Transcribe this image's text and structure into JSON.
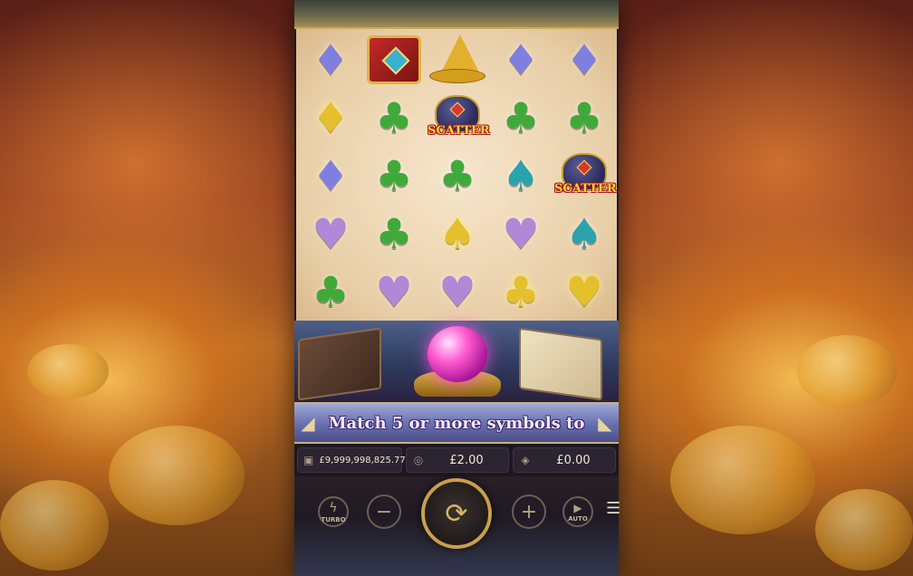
{
  "game": {
    "reels": [
      [
        "diamond",
        "book-wild",
        "hat-wild",
        "diamond",
        "diamond"
      ],
      [
        "diamond-gold",
        "club",
        "scatter",
        "club",
        "club"
      ],
      [
        "diamond",
        "club",
        "club",
        "spade",
        "scatter"
      ],
      [
        "heart",
        "club",
        "spade-gold",
        "heart",
        "spade"
      ],
      [
        "club",
        "heart",
        "heart",
        "club-gold",
        "heart-gold"
      ]
    ],
    "scatter_label": "SCATTER",
    "banner_text": "Match 5 or more symbols to",
    "colors": {
      "diamond": "#7f7fe0",
      "club": "#3faa3a",
      "heart": "#b088d8",
      "spade": "#2aa3ad",
      "gold": "#e5c02d"
    }
  },
  "info_bar": {
    "balance_icon": "wallet-icon",
    "balance": "£9,999,998,825.77",
    "bet_icon": "coin-stack-icon",
    "bet": "£2.00",
    "win_icon": "win-icon",
    "win": "£0.00"
  },
  "controls": {
    "turbo_label": "TURBO",
    "auto_label": "AUTO",
    "minus_symbol": "−",
    "plus_symbol": "+",
    "spin_symbol": "⟳",
    "menu_symbol": "☰"
  },
  "symbols": {
    "diamond": "♦",
    "club": "♣",
    "heart": "♥",
    "spade": "♠"
  }
}
